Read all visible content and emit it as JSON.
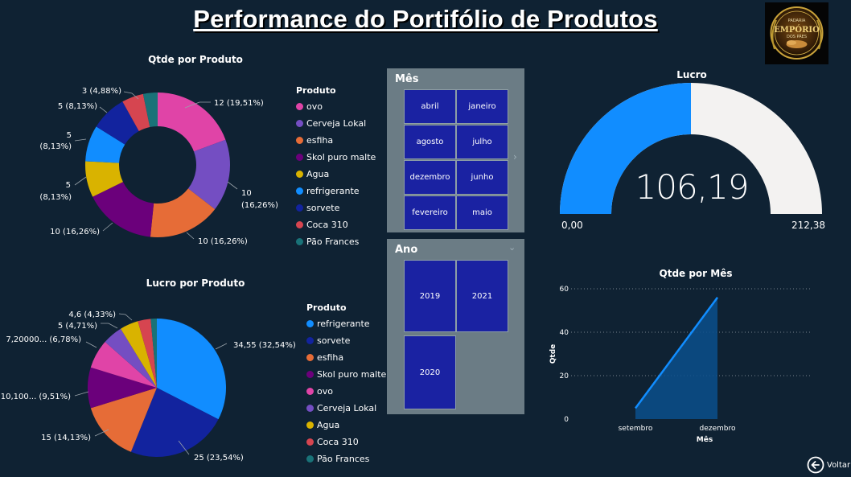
{
  "page": {
    "title": "Performance  do Portifólio de Produtos",
    "back_label": "Voltar",
    "logo": {
      "line1": "PADARIA",
      "line2": "EMPÓRIO",
      "line3": "DOS PÃES"
    }
  },
  "qtde_por_produto": {
    "title": "Qtde por Produto",
    "legend_title": "Produto",
    "legend": [
      {
        "label": "ovo",
        "color": "#e044a7"
      },
      {
        "label": "Cerveja Lokal",
        "color": "#744ec2"
      },
      {
        "label": "esfiha",
        "color": "#e66c37"
      },
      {
        "label": "Skol puro malte",
        "color": "#6b007b"
      },
      {
        "label": "Agua",
        "color": "#d9b300"
      },
      {
        "label": "refrigerante",
        "color": "#118dff"
      },
      {
        "label": "sorvete",
        "color": "#12239e"
      },
      {
        "label": "Coca 310",
        "color": "#d64550"
      },
      {
        "label": "Pão Frances",
        "color": "#197278"
      }
    ],
    "labels": {
      "ovo": "12 (19,51%)",
      "cerveja_l1": "10",
      "cerveja_l2": "(16,26%)",
      "esfiha": "10 (16,26%)",
      "skol": "10 (16,26%)",
      "agua_l1": "5",
      "agua_l2": "(8,13%)",
      "refri_l1": "5",
      "refri_l2": "(8,13%)",
      "sorvete": "5 (8,13%)",
      "coca": "3 (4,88%)"
    }
  },
  "lucro_por_produto": {
    "title": "Lucro por Produto",
    "legend_title": "Produto",
    "legend": [
      {
        "label": "refrigerante",
        "color": "#118dff"
      },
      {
        "label": "sorvete",
        "color": "#12239e"
      },
      {
        "label": "esfiha",
        "color": "#e66c37"
      },
      {
        "label": "Skol puro malte",
        "color": "#6b007b"
      },
      {
        "label": "ovo",
        "color": "#e044a7"
      },
      {
        "label": "Cerveja Lokal",
        "color": "#744ec2"
      },
      {
        "label": "Agua",
        "color": "#d9b300"
      },
      {
        "label": "Coca 310",
        "color": "#d64550"
      },
      {
        "label": "Pão Frances",
        "color": "#197278"
      }
    ],
    "labels": {
      "refri": "34,55 (32,54%)",
      "sorvete": "25 (23,54%)",
      "esfiha": "15 (14,13%)",
      "skol": "10,100... (9,51%)",
      "ovo": "7,20000... (6,78%)",
      "cerveja": "5 (4,71%)",
      "agua": "4,6 (4,33%)"
    }
  },
  "mes_slicer": {
    "title": "Mês",
    "options": [
      "abril",
      "janeiro",
      "agosto",
      "julho",
      "dezembro",
      "junho",
      "fevereiro",
      "maio"
    ]
  },
  "ano_slicer": {
    "title": "Ano",
    "options": [
      "2019",
      "2021",
      "2020"
    ]
  },
  "lucro_gauge": {
    "title": "Lucro",
    "value_label": "106,19",
    "min_label": "0,00",
    "max_label": "212,38",
    "value": 106.19,
    "min": 0,
    "max": 212.38,
    "fill_color": "#118dff",
    "track_color": "#f3f2f1"
  },
  "chart_data": [
    {
      "type": "pie",
      "title": "Qtde por Produto",
      "variant": "donut",
      "categories": [
        "ovo",
        "Cerveja Lokal",
        "esfiha",
        "Skol puro malte",
        "Agua",
        "refrigerante",
        "sorvete",
        "Coca 310",
        "Pão Frances"
      ],
      "values": [
        12,
        10,
        10,
        10,
        5,
        5,
        5,
        3,
        2
      ],
      "colors": [
        "#e044a7",
        "#744ec2",
        "#e66c37",
        "#6b007b",
        "#d9b300",
        "#118dff",
        "#12239e",
        "#d64550",
        "#197278"
      ]
    },
    {
      "type": "pie",
      "title": "Lucro por Produto",
      "categories": [
        "refrigerante",
        "sorvete",
        "esfiha",
        "Skol puro malte",
        "ovo",
        "Cerveja Lokal",
        "Agua",
        "Coca 310",
        "Pão Frances"
      ],
      "values": [
        34.55,
        25,
        15,
        10.1,
        7.2,
        5,
        4.6,
        3.2,
        1.5
      ],
      "colors": [
        "#118dff",
        "#12239e",
        "#e66c37",
        "#6b007b",
        "#e044a7",
        "#744ec2",
        "#d9b300",
        "#d64550",
        "#197278"
      ]
    },
    {
      "type": "area",
      "title": "Qtde por Mês",
      "xlabel": "Mês",
      "ylabel": "Qtde",
      "categories": [
        "setembro",
        "dezembro"
      ],
      "values": [
        5,
        56
      ],
      "ylim": [
        0,
        60
      ],
      "yticks": [
        "0",
        "20",
        "40",
        "60"
      ],
      "line_color": "#118dff",
      "fill_color": "#0b4f8c",
      "grid": true
    }
  ]
}
